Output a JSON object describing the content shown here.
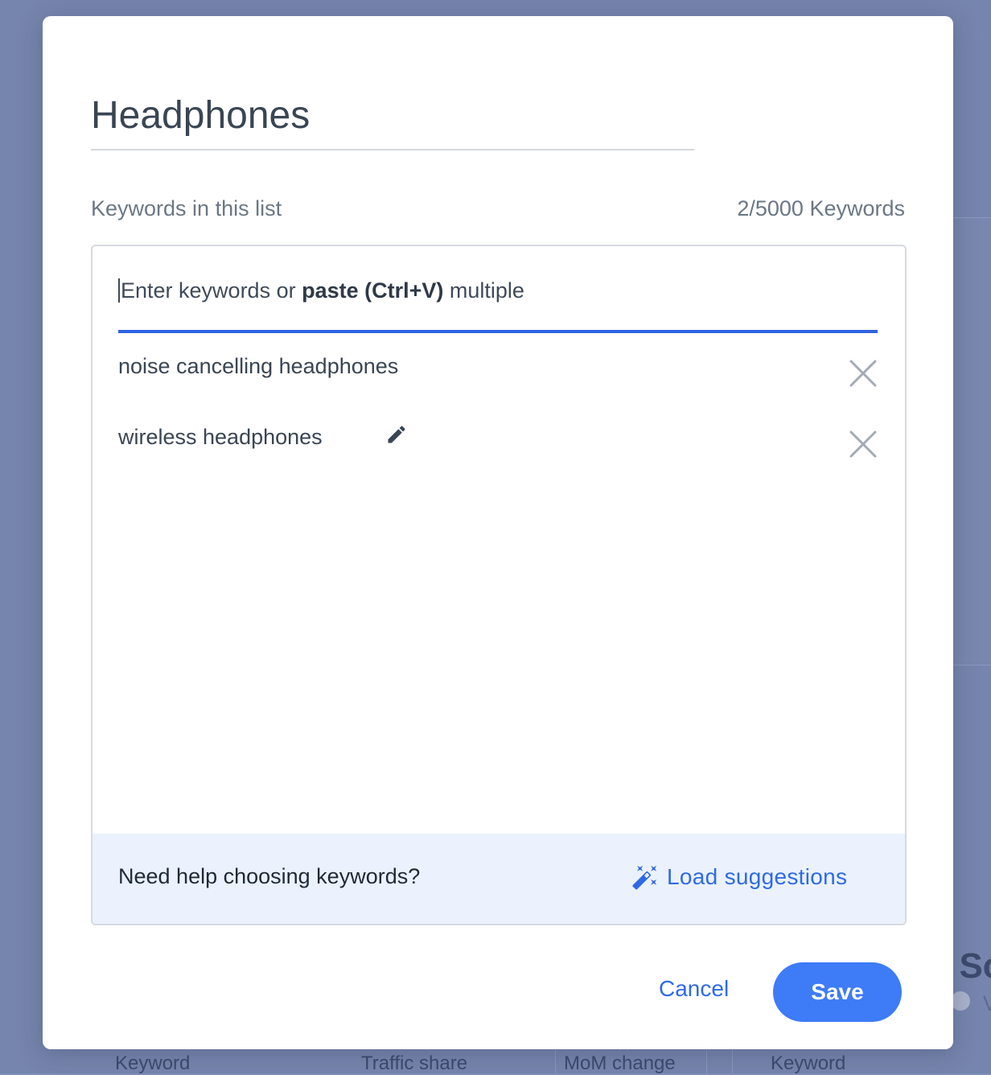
{
  "dialog": {
    "list_name": "Headphones",
    "keywords_label": "Keywords in this list",
    "keywords_count": "2/5000 Keywords",
    "input": {
      "placeholder_prefix": "Enter keywords or ",
      "placeholder_bold": "paste (Ctrl+V)",
      "placeholder_suffix": " multiple"
    },
    "keywords": [
      {
        "text": "noise cancelling headphones",
        "icon": "close-icon"
      },
      {
        "text": "wireless headphones",
        "icon": "close-icon",
        "edit_icon": "pencil-icon"
      }
    ],
    "help": {
      "text": "Need help choosing keywords?",
      "load_label": "Load suggestions",
      "icon": "magic-wand-icon"
    },
    "cancel_label": "Cancel",
    "save_label": "Save"
  },
  "background": {
    "columns": [
      "Keyword",
      "Traffic share",
      "MoM change",
      "Keyword"
    ],
    "right_heading_fragment": "l Sc",
    "right_sub_fragment": "V"
  },
  "colors": {
    "accent": "#2f6ae6",
    "save_button": "#3e7bf6",
    "input_underline": "#2e63e0",
    "help_bar": "#ebf2fd",
    "overlay": "#7685ad"
  }
}
